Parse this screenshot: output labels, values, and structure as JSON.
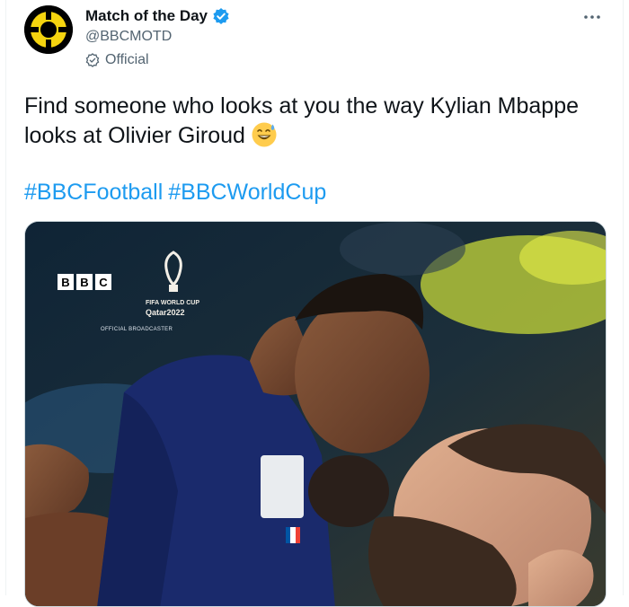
{
  "account": {
    "name": "Match of the Day",
    "handle": "@BBCMOTD",
    "label": "Official"
  },
  "tweet": {
    "text": "Find someone who looks at you the way Kylian Mbappe looks at Olivier Giroud",
    "hashtags": [
      "#BBCFootball",
      "#BBCWorldCup"
    ]
  },
  "media": {
    "bbc_letters": [
      "B",
      "B",
      "C"
    ],
    "broadcaster": "OFFICIAL BROADCASTER",
    "wc_title": "FIFA WORLD CUP",
    "wc_sub": "Qatar2022"
  },
  "icons": {
    "verified": "verified-badge-icon",
    "official": "official-check-icon",
    "more": "more-dots-icon",
    "emoji": "sweat-smile-emoji"
  },
  "colors": {
    "link": "#1d9bf0",
    "muted": "#536471",
    "avatar_yellow": "#f5d40f"
  }
}
